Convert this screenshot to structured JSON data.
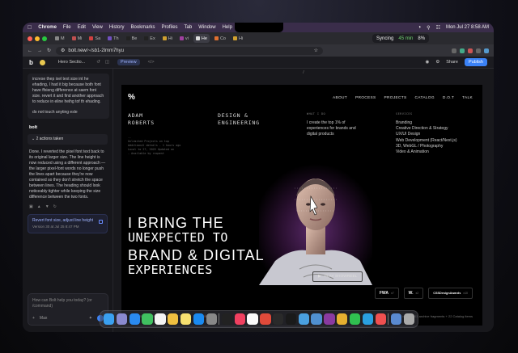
{
  "menubar": {
    "app": "Chrome",
    "items": [
      "File",
      "Edit",
      "View",
      "History",
      "Bookmarks",
      "Profiles",
      "Tab",
      "Window",
      "Help"
    ],
    "clock": "Mon Jul 27  8:58 AM"
  },
  "browser": {
    "tabs": [
      {
        "label": "M"
      },
      {
        "label": "Mi"
      },
      {
        "label": "Sa"
      },
      {
        "label": "Th"
      },
      {
        "label": "Be"
      },
      {
        "label": "Ex"
      },
      {
        "label": "Hi"
      },
      {
        "label": "vi"
      },
      {
        "label": "He",
        "active": true
      },
      {
        "label": "Co"
      },
      {
        "label": "Hi"
      },
      {
        "label": "Ac"
      }
    ],
    "syncing": {
      "label": "Syncing",
      "minutes": "45 min",
      "percent": "8%"
    },
    "url": "bolt.new/~/sb1-2lmm7hyu"
  },
  "bolt": {
    "project": "Hero Sectio...",
    "preview_label": "Preview",
    "share": "Share",
    "publish": "Publish",
    "user_message": "increse thep ixel text size int he ehading, I had it big because both font have ffxieng difference at saem font size. revert it and find another approach to reduce in eline heihg tof th ehading.",
    "user_message_2": "do not touch anyting esle",
    "bolt_label": "bolt",
    "actions_taken": "2 actions taken",
    "reply": "Done. I reverted the pixel font text back to its original larger size. The line height is now reduced using a different approach — the larger pixel-font words no longer push the lines apart because they're now contained so they don't stretch the space between lines. The heading should look noticeably tighter while keeping the size difference between the two fonts.",
    "card_title": "Revert font size, adjust line height",
    "card_sub": "Version 30 at Jul 25 8:47 PM",
    "chat_placeholder": "How can Bolt help you today? (or /command)",
    "model": "Max"
  },
  "site": {
    "logo": "%",
    "nav": [
      "ABOUT",
      "PROCESS",
      "PROJECTS",
      "CATALOG",
      "D.O.T",
      "TALK"
    ],
    "name_line1": "ADAM",
    "name_line2": "ROBERTS",
    "role_line1": "DESIGN &",
    "role_line2": "ENGINEERING",
    "coords": [
      "--",
      "Unlimited Projects on top",
      "Additional details - 1 hours ago",
      "Local to 27, 2025 Updated on",
      "- Available by request"
    ],
    "whatido_label": "WHAT I DO",
    "whatido_text": "I create the top 1% of experiences for brands and digital products",
    "services_label": "SERVICES",
    "services": [
      "Branding",
      "Creative Direction & Strategy",
      "UX/UI Design",
      "Web Development (React/Next.js)",
      "3D, WebGL / Photography",
      "Video & Animation"
    ],
    "headline": [
      "I BRING THE",
      "UNEXPECTED TO",
      "BRAND & DIGITAL",
      "EXPERIENCES"
    ],
    "showreel": "PLAY SHOWREEL",
    "awards": [
      {
        "label": "FWA",
        "count": "x7"
      },
      {
        "label": "W.",
        "count": "x2"
      },
      {
        "label": "CSSDesignAwards",
        "count": "x10"
      }
    ],
    "footer_left": "Open to freelance, contract or full-time.",
    "footer_link": "Schedule a call",
    "footer_right": "3 Full cases + 63 archive fragments + 22 Catalog items"
  },
  "colors": {
    "accent": "#3b82f6",
    "link": "#f07a4a",
    "menubar": "#3a2d4a"
  },
  "dock_icons": [
    "finder-icon",
    "launchpad-icon",
    "safari-icon",
    "messages-icon",
    "calendar-icon",
    "photos-icon",
    "notes-icon",
    "appstore-icon",
    "settings-icon",
    "terminal-icon",
    "music-icon",
    "notion-icon",
    "chrome-icon",
    "figma-icon",
    "capcut-icon",
    "preview-icon",
    "finder2-icon",
    "slack-icon",
    "chrome2-icon",
    "whatsapp-icon",
    "telegram-icon",
    "raycast-icon",
    "folder-icon",
    "trash-icon"
  ]
}
